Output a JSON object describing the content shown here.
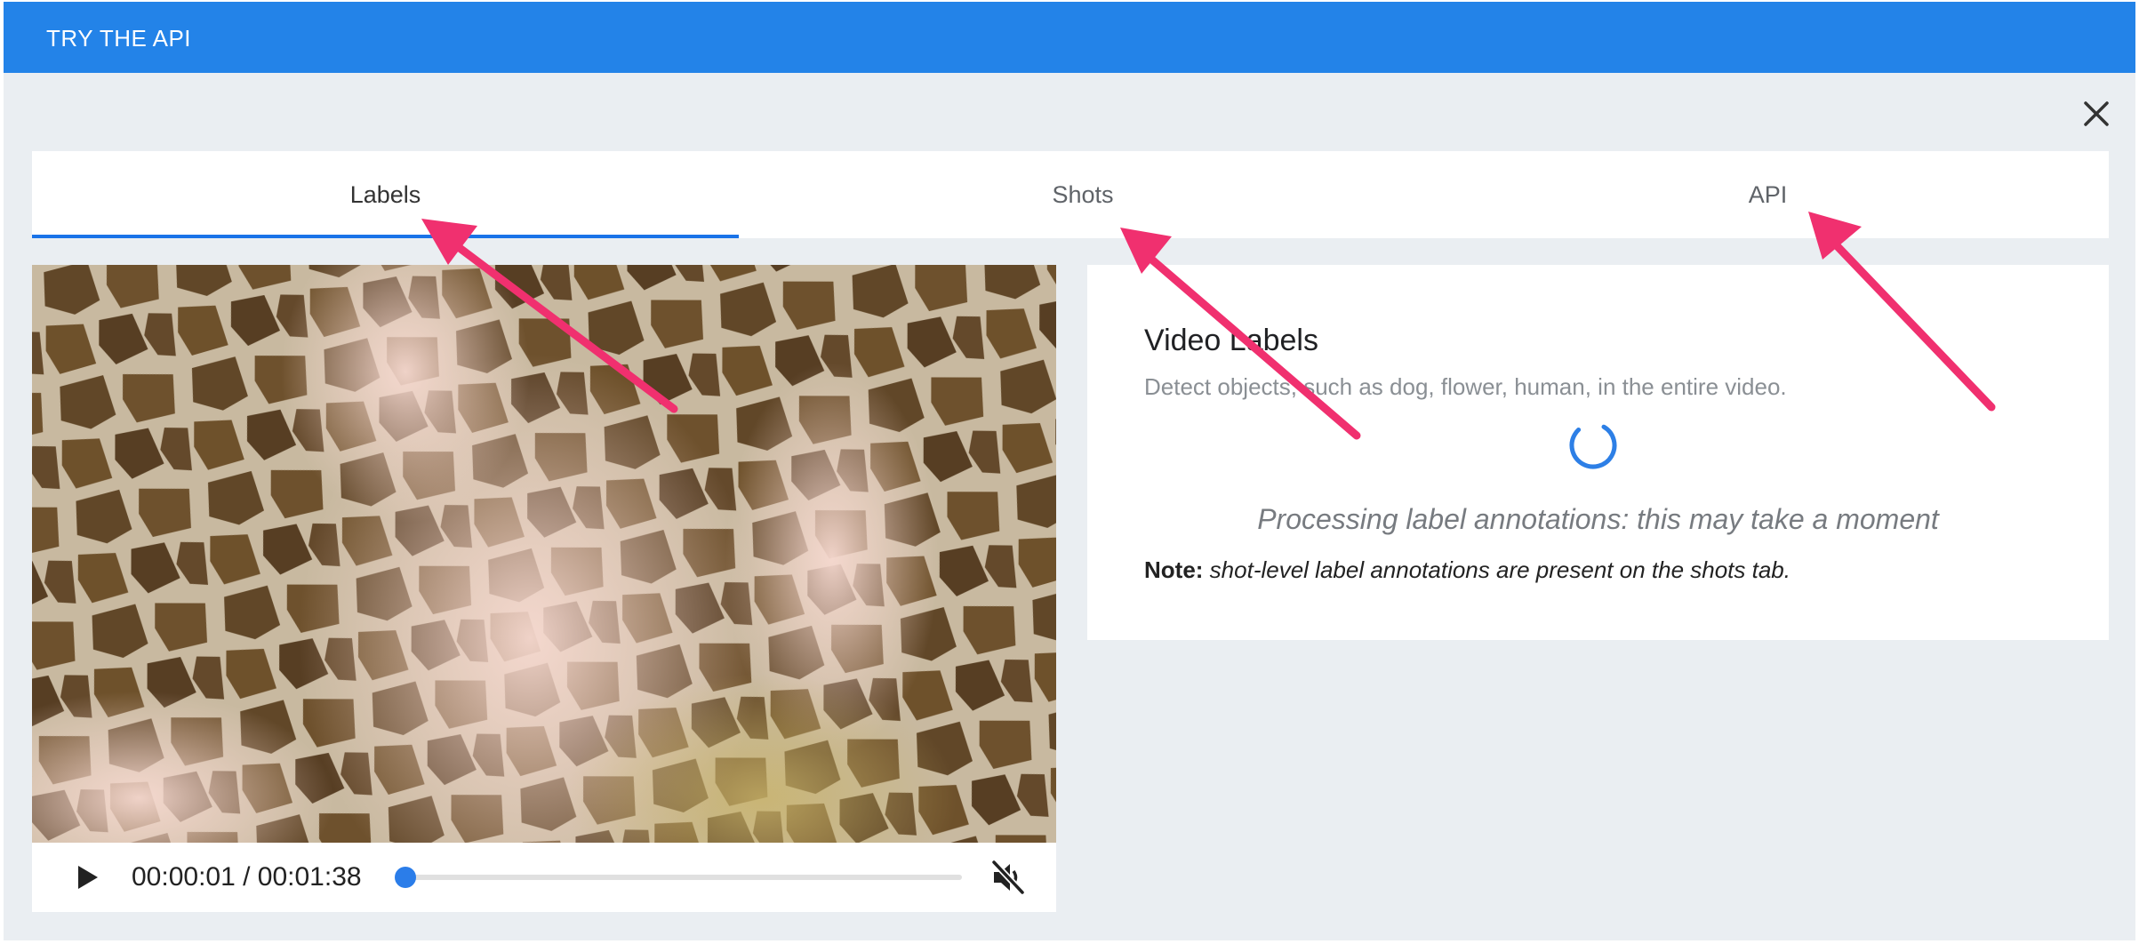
{
  "header": {
    "title": "TRY THE API"
  },
  "tabs": [
    {
      "label": "Labels",
      "active": true
    },
    {
      "label": "Shots",
      "active": false
    },
    {
      "label": "API",
      "active": false
    }
  ],
  "player": {
    "current_time": "00:00:01",
    "duration": "00:01:38",
    "time_display": "00:00:01 / 00:01:38",
    "progress_fraction": 0.01,
    "muted": true
  },
  "labels_panel": {
    "title": "Video Labels",
    "subtitle": "Detect objects, such as dog, flower, human, in the entire video.",
    "processing_message": "Processing label annotations: this may take a moment",
    "note_label": "Note:",
    "note_text": "shot-level label annotations are present on the shots tab."
  },
  "icons": {
    "close": "close-icon",
    "play": "play-icon",
    "mute": "volume-muted-icon",
    "spinner": "loading-spinner-icon"
  },
  "colors": {
    "header_bg": "#2383e8",
    "accent": "#1a73e8",
    "arrow": "#f0306f",
    "page_bg": "#eaeef2"
  }
}
